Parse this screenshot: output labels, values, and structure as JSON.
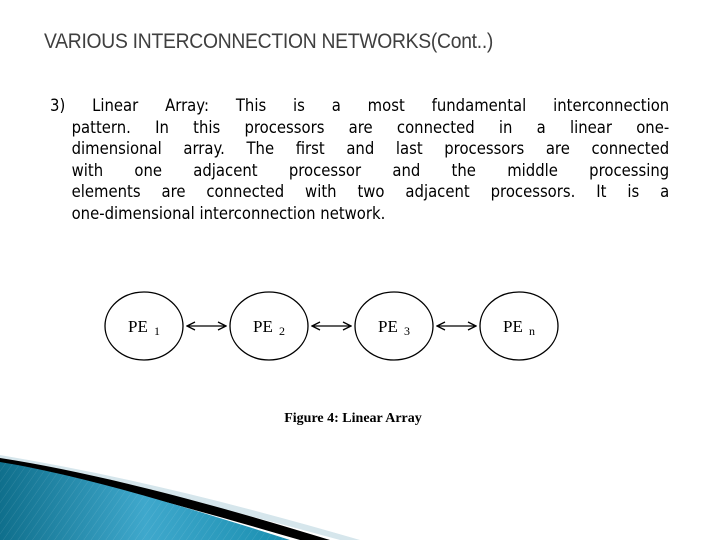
{
  "slide": {
    "title": "VARIOUS INTERCONNECTION NETWORKS(Cont..)",
    "paragraph": {
      "first_line": "3) Linear Array: This is a most fundamental interconnection",
      "lines": [
        "pattern. In this processors are connected in a linear one-",
        "dimensional array. The first and last processors are connected",
        "with one adjacent processor and the middle processing",
        "elements are connected with two adjacent processors. It is a",
        "one-dimensional interconnection network."
      ]
    }
  },
  "figure": {
    "nodes": [
      {
        "label": "PE",
        "sub": "1"
      },
      {
        "label": "PE",
        "sub": "2"
      },
      {
        "label": "PE",
        "sub": "3"
      },
      {
        "label": "PE",
        "sub": "n"
      }
    ],
    "connections": [
      {
        "from": 0,
        "to": 1,
        "type": "bidirectional"
      },
      {
        "from": 1,
        "to": 2,
        "type": "bidirectional"
      },
      {
        "from": 2,
        "to": 3,
        "type": "bidirectional"
      }
    ],
    "caption": "Figure 4: Linear Array"
  },
  "theme": {
    "title_color": "#3f3f3f",
    "accent_teal": "#1a8fb0",
    "accent_dark": "#000000",
    "accent_light": "#d6e6ec"
  }
}
